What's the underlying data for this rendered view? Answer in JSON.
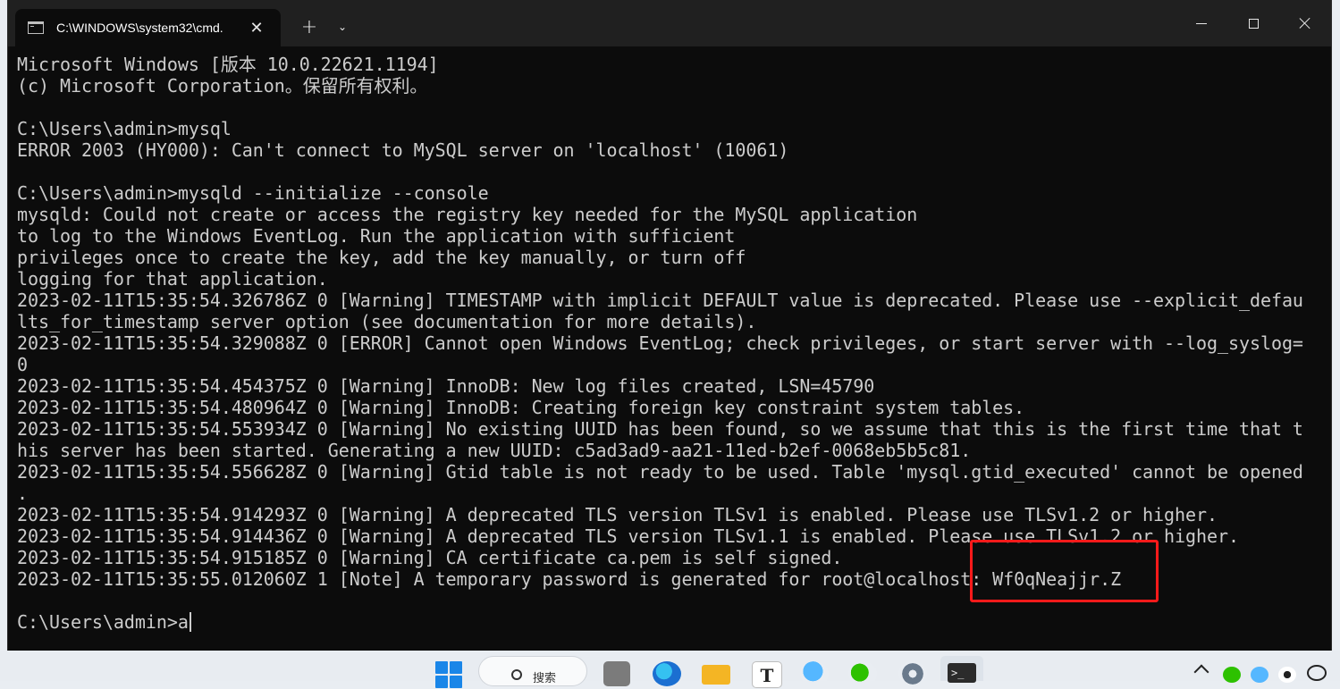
{
  "window": {
    "tab_title": "C:\\WINDOWS\\system32\\cmd.",
    "tab_close_glyph": "✕",
    "new_tab_glyph": "+",
    "dropdown_glyph": "⌄"
  },
  "terminal": {
    "lines": [
      "Microsoft Windows [版本 10.0.22621.1194]",
      "(c) Microsoft Corporation。保留所有权利。",
      "",
      "C:\\Users\\admin>mysql",
      "ERROR 2003 (HY000): Can't connect to MySQL server on 'localhost' (10061)",
      "",
      "C:\\Users\\admin>mysqld --initialize --console",
      "mysqld: Could not create or access the registry key needed for the MySQL application",
      "to log to the Windows EventLog. Run the application with sufficient",
      "privileges once to create the key, add the key manually, or turn off",
      "logging for that application.",
      "2023-02-11T15:35:54.326786Z 0 [Warning] TIMESTAMP with implicit DEFAULT value is deprecated. Please use --explicit_defau",
      "lts_for_timestamp server option (see documentation for more details).",
      "2023-02-11T15:35:54.329088Z 0 [ERROR] Cannot open Windows EventLog; check privileges, or start server with --log_syslog=",
      "0",
      "2023-02-11T15:35:54.454375Z 0 [Warning] InnoDB: New log files created, LSN=45790",
      "2023-02-11T15:35:54.480964Z 0 [Warning] InnoDB: Creating foreign key constraint system tables.",
      "2023-02-11T15:35:54.553934Z 0 [Warning] No existing UUID has been found, so we assume that this is the first time that t",
      "his server has been started. Generating a new UUID: c5ad3ad9-aa21-11ed-b2ef-0068eb5b5c81.",
      "2023-02-11T15:35:54.556628Z 0 [Warning] Gtid table is not ready to be used. Table 'mysql.gtid_executed' cannot be opened",
      ".",
      "2023-02-11T15:35:54.914293Z 0 [Warning] A deprecated TLS version TLSv1 is enabled. Please use TLSv1.2 or higher.",
      "2023-02-11T15:35:54.914436Z 0 [Warning] A deprecated TLS version TLSv1.1 is enabled. Please use TLSv1.2 or higher.",
      "2023-02-11T15:35:54.915185Z 0 [Warning] CA certificate ca.pem is self signed.",
      "2023-02-11T15:35:55.012060Z 1 [Note] A temporary password is generated for root@localhost: Wf0qNeajjr.Z",
      ""
    ],
    "prompt": "C:\\Users\\admin>",
    "input": "a"
  },
  "taskbar": {
    "search_label": "搜索",
    "terminal_glyph": ">_"
  },
  "colors": {
    "terminal_bg": "#0c0c0c",
    "terminal_fg": "#cccccc",
    "highlight": "#ff1a1a",
    "titlebar": "#202020"
  }
}
